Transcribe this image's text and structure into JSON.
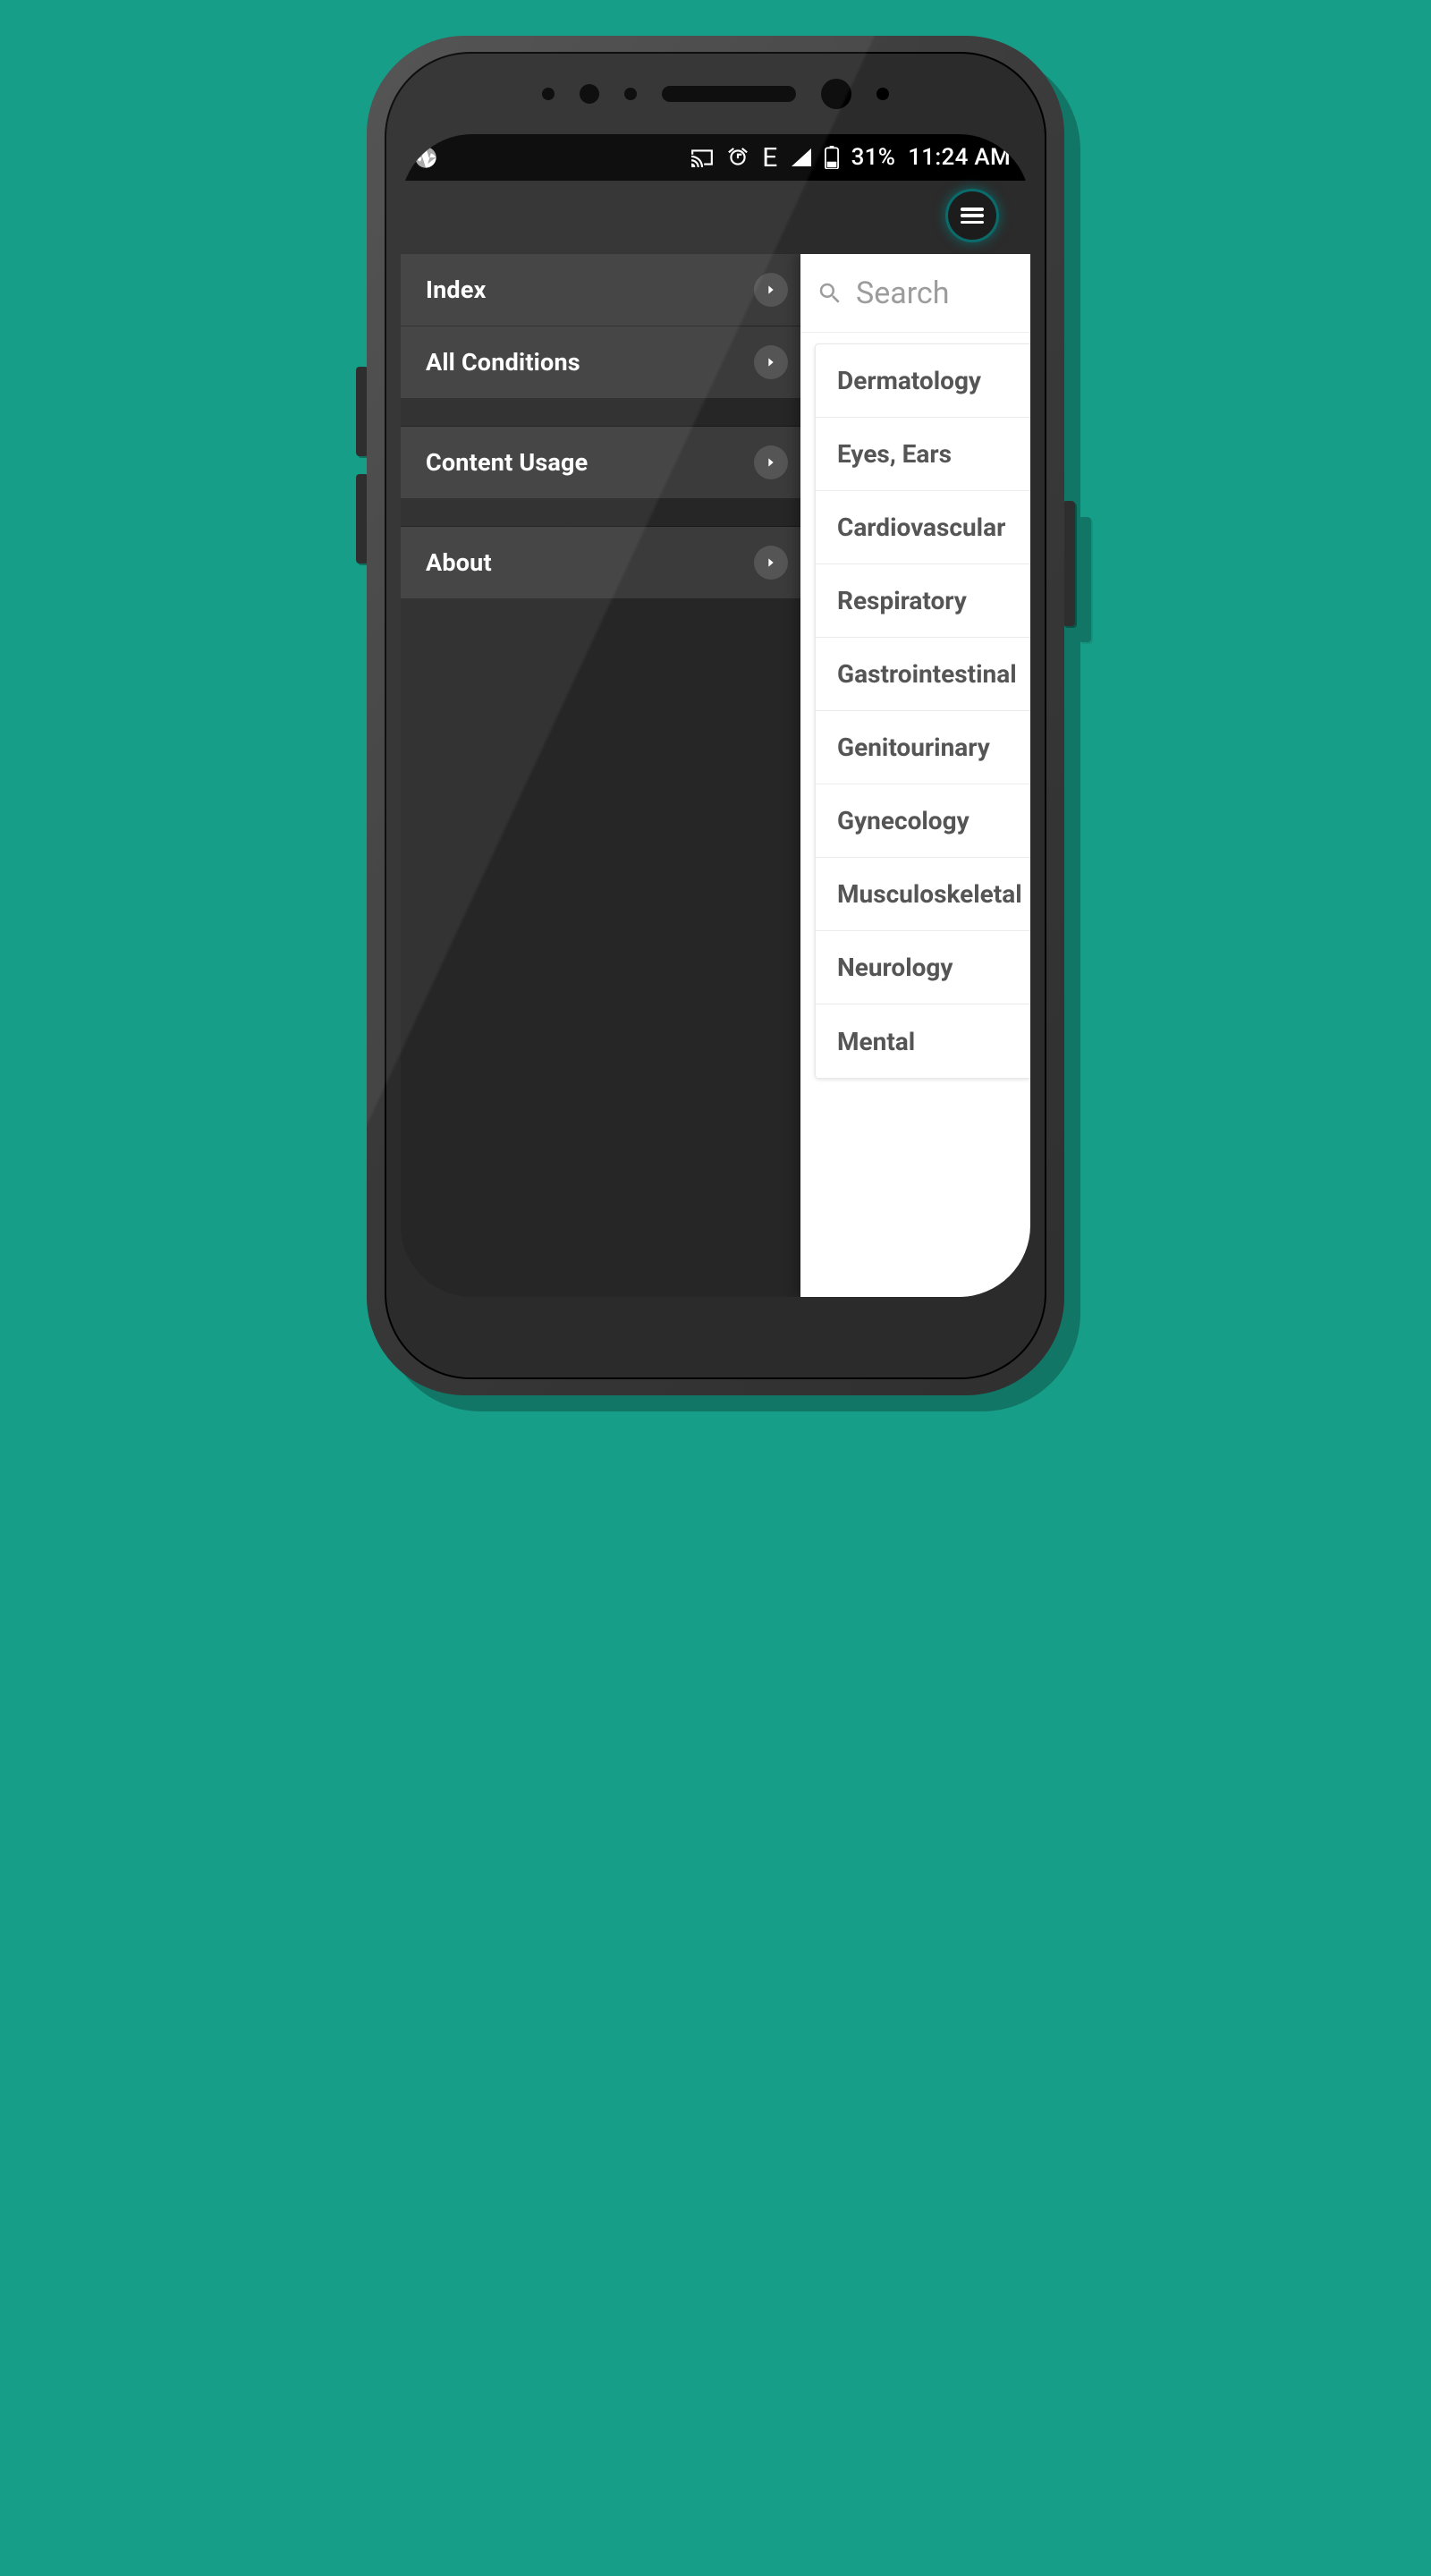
{
  "status": {
    "battery_pct": "31%",
    "time": "11:24 AM",
    "network_indicator": "E"
  },
  "drawer": {
    "items": [
      {
        "label": "Index"
      },
      {
        "label": "All Conditions"
      },
      {
        "label": "Content Usage"
      },
      {
        "label": "About"
      }
    ]
  },
  "search": {
    "placeholder": "Search"
  },
  "categories": [
    "Dermatology",
    "Eyes, Ears",
    "Cardiovascular",
    "Respiratory",
    "Gastrointestinal",
    "Genitourinary",
    "Gynecology",
    "Musculoskeletal",
    "Neurology",
    "Mental"
  ]
}
